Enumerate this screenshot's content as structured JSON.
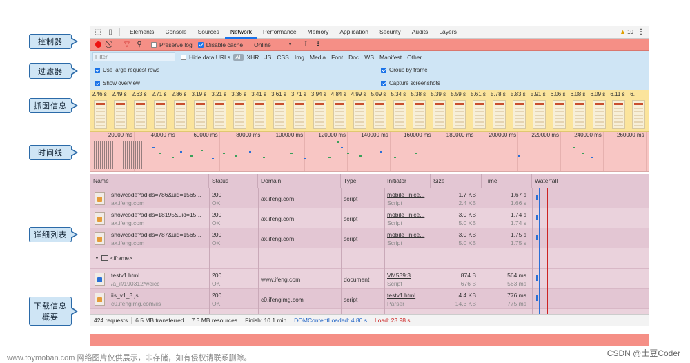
{
  "callouts": {
    "controls": "控制器",
    "filters": "过滤器",
    "screenshots": "抓图信息",
    "timeline": "时间线",
    "details": "详细列表",
    "summary_line1": "下载信息",
    "summary_line2": "概要"
  },
  "tabs": {
    "items": [
      "Elements",
      "Console",
      "Sources",
      "Network",
      "Performance",
      "Memory",
      "Application",
      "Security",
      "Audits",
      "Layers"
    ],
    "active": "Network",
    "warnings": "10"
  },
  "toolbar": {
    "preserve_log": "Preserve log",
    "disable_cache": "Disable cache",
    "throttle": "Online"
  },
  "filter": {
    "placeholder": "Filter",
    "hide_data_urls": "Hide data URLs",
    "types": [
      "All",
      "XHR",
      "JS",
      "CSS",
      "Img",
      "Media",
      "Font",
      "Doc",
      "WS",
      "Manifest",
      "Other"
    ]
  },
  "options": {
    "large_rows": "Use large request rows",
    "group_frame": "Group by frame",
    "show_overview": "Show overview",
    "capture_screenshots": "Capture screenshots"
  },
  "screenshot_times": [
    "2.46 s",
    "2.49 s",
    "2.63 s",
    "2.71 s",
    "2.86 s",
    "3.19 s",
    "3.21 s",
    "3.36 s",
    "3.41 s",
    "3.61 s",
    "3.71 s",
    "3.94 s",
    "4.84 s",
    "4.99 s",
    "5.09 s",
    "5.34 s",
    "5.38 s",
    "5.39 s",
    "5.59 s",
    "5.61 s",
    "5.78 s",
    "5.83 s",
    "5.91 s",
    "6.06 s",
    "6.08 s",
    "6.09 s",
    "6.11 s",
    "6."
  ],
  "timeline_ticks": [
    "20000 ms",
    "40000 ms",
    "60000 ms",
    "80000 ms",
    "100000 ms",
    "120000 ms",
    "140000 ms",
    "160000 ms",
    "180000 ms",
    "200000 ms",
    "220000 ms",
    "240000 ms",
    "260000 ms"
  ],
  "table": {
    "headers": [
      "Name",
      "Status",
      "Domain",
      "Type",
      "Initiator",
      "Size",
      "Time",
      "Waterfall"
    ],
    "rows": [
      {
        "name": "showcode?adids=786&uid=1565...",
        "path": "ax.ifeng.com",
        "status": "200",
        "status_text": "OK",
        "domain": "ax.ifeng.com",
        "type": "script",
        "initiator": "mobile_inice...",
        "initiator_sub": "Script",
        "size": "1.7 KB",
        "size_sub": "2.4 KB",
        "time": "1.67 s",
        "time_sub": "1.66 s"
      },
      {
        "name": "showcode?adids=18195&uid=15...",
        "path": "ax.ifeng.com",
        "status": "200",
        "status_text": "OK",
        "domain": "ax.ifeng.com",
        "type": "script",
        "initiator": "mobile_inice...",
        "initiator_sub": "Script",
        "size": "3.0 KB",
        "size_sub": "5.0 KB",
        "time": "1.74 s",
        "time_sub": "1.74 s"
      },
      {
        "name": "showcode?adids=787&uid=1565...",
        "path": "ax.ifeng.com",
        "status": "200",
        "status_text": "OK",
        "domain": "ax.ifeng.com",
        "type": "script",
        "initiator": "mobile_inice...",
        "initiator_sub": "Script",
        "size": "3.0 KB",
        "size_sub": "5.0 KB",
        "time": "1.75 s",
        "time_sub": "1.75 s"
      }
    ],
    "group_label": "<iframe>",
    "rows2": [
      {
        "name": "testv1.html",
        "path": "/a_if/190312/weicc",
        "status": "200",
        "status_text": "OK",
        "domain": "www.ifeng.com",
        "type": "document",
        "initiator": "VM539:3",
        "initiator_sub": "Script",
        "size": "874 B",
        "size_sub": "676 B",
        "time": "564 ms",
        "time_sub": "563 ms"
      },
      {
        "name": "iis_v1_3.js",
        "path": "c0.ifengimg.com/iis",
        "status": "200",
        "status_text": "OK",
        "domain": "c0.ifengimg.com",
        "type": "script",
        "initiator": "testv1.html",
        "initiator_sub": "Parser",
        "size": "4.4 KB",
        "size_sub": "14.3 KB",
        "time": "776 ms",
        "time_sub": "775 ms"
      }
    ]
  },
  "status": {
    "requests": "424 requests",
    "transferred": "6.5 MB transferred",
    "resources": "7.3 MB resources",
    "finish": "Finish: 10.1 min",
    "dcl": "DOMContentLoaded: 4.80 s",
    "load": "Load: 23.98 s"
  },
  "footer": {
    "watermark": "www.toymoban.com 网络图片仅供展示，非存储，如有侵权请联系删除。",
    "csdn": "CSDN @土豆Coder"
  },
  "colors": {
    "controls": "#f58f86",
    "filters": "#cfe5f5",
    "screenshots": "#fbe49c",
    "timeline": "#f8c6c4",
    "details": "#ead2dc"
  }
}
